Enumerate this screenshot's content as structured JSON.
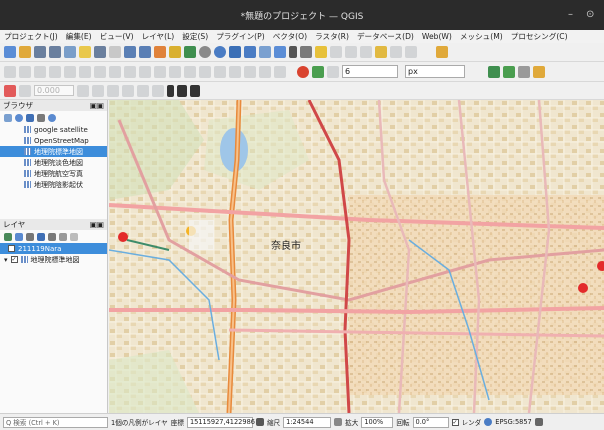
{
  "window": {
    "title": "*無題のプロジェクト — QGIS",
    "min": "–",
    "restore": "⊙"
  },
  "menu": [
    "プロジェクト(J)",
    "編集(E)",
    "ビュー(V)",
    "レイヤ(L)",
    "設定(S)",
    "プラグイン(P)",
    "ベクタ(O)",
    "ラスタ(R)",
    "データベース(D)",
    "Web(W)",
    "メッシュ(M)",
    "プロセシング(C)"
  ],
  "toolbar": {
    "width_value": "6",
    "unit": "px",
    "scale_field": "0.000"
  },
  "browser": {
    "title": "ブラウザ",
    "items": [
      "google satellite",
      "OpenStreetMap",
      "地理院標準地図",
      "地理院淡色地図",
      "地理院航空写真",
      "地理院陰影起伏"
    ],
    "selected_index": 2
  },
  "layers": {
    "title": "レイヤ",
    "items": [
      {
        "label": "211119Nara",
        "checked": true,
        "selected": true
      },
      {
        "label": "地理院標準地図",
        "checked": true,
        "selected": false
      }
    ]
  },
  "map": {
    "city_label": "奈良市"
  },
  "status": {
    "search_placeholder": "Q 検索 (Ctrl + K)",
    "legend_msg": "1個の凡例がレイヤ",
    "coord_label": "座標",
    "coord_value": "15115927,4122986",
    "scale_label": "縮尺",
    "scale_value": "1:24544",
    "zoom_label": "拡大",
    "zoom_value": "100%",
    "rotation_label": "回転",
    "rotation_value": "0.0°",
    "render_label": "レンダ",
    "crs": "EPSG:5857"
  },
  "colors": {
    "title_bg": "#2b2b2b",
    "selection": "#3d8ddb",
    "map_bg": "#f1e9d6"
  }
}
